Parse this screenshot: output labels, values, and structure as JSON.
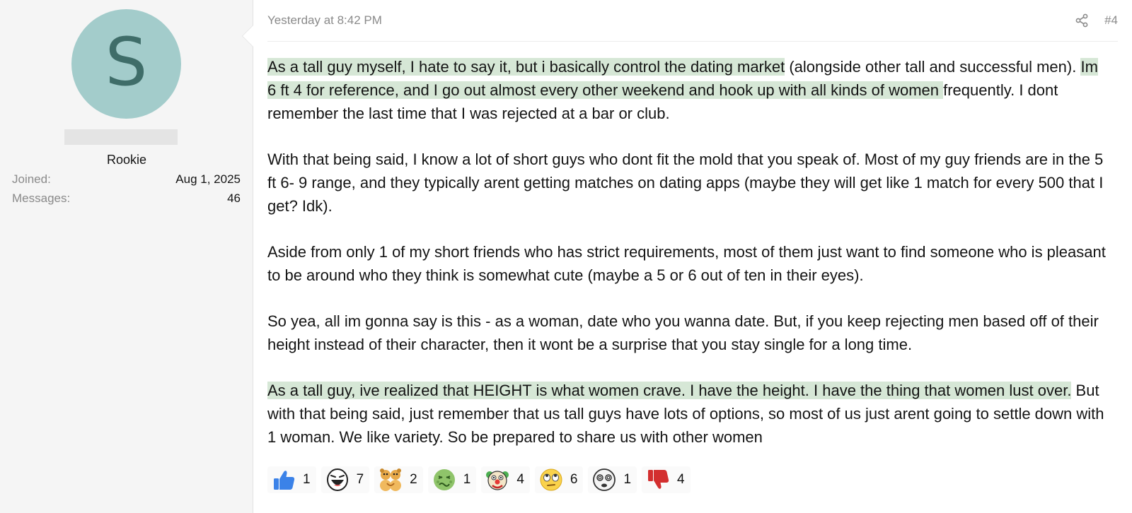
{
  "user": {
    "avatar_letter": "S",
    "title": "Rookie",
    "stats": [
      {
        "label": "Joined:",
        "value": "Aug 1, 2025"
      },
      {
        "label": "Messages:",
        "value": "46"
      }
    ]
  },
  "post": {
    "date": "Yesterday at 8:42 PM",
    "number": "#4",
    "p1": {
      "hl1": "As a tall guy myself, I hate to say it, but i basically control the dating market",
      "t1": " (alongside other tall and successful men). ",
      "hl2": "Im 6 ft 4 for reference, and I go out almost every other weekend and hook up with all kinds of women ",
      "t2": " frequently. I dont remember the last time that I was rejected at a bar or club."
    },
    "p2": "With that being said, I know a lot of short guys who dont fit the mold that you speak of. Most of my guy friends are in the 5 ft 6- 9 range, and they typically arent getting matches on dating apps (maybe they will get like 1 match for every 500 that I get? Idk).",
    "p3": "Aside from only 1 of my short friends who has strict requirements, most of them just want to find someone who is pleasant to be around who they think is somewhat cute (maybe a 5 or 6 out of ten in their eyes).",
    "p4": "So yea, all im gonna say is this - as a woman, date who you wanna date. But, if you keep rejecting men based off of their height instead of their character, then it wont be a surprise that you stay single for a long time.",
    "p5": {
      "hl1": "As a tall guy, ive realized that HEIGHT is what women crave. I have the height. I have the thing that women lust over.",
      "t1": " But with that being said, just remember that us tall guys have lots of options, so most of us just arent going to settle down with 1 woman. We like variety. So be prepared to share us with other women"
    }
  },
  "reactions": [
    {
      "icon": "thumbs-up-icon",
      "count": "1"
    },
    {
      "icon": "laughing-face-icon",
      "count": "7"
    },
    {
      "icon": "hugging-bears-icon",
      "count": "2"
    },
    {
      "icon": "nauseated-face-icon",
      "count": "1"
    },
    {
      "icon": "clown-face-icon",
      "count": "4"
    },
    {
      "icon": "eye-roll-face-icon",
      "count": "6"
    },
    {
      "icon": "dizzy-face-icon",
      "count": "1"
    },
    {
      "icon": "thumbs-down-icon",
      "count": "4"
    }
  ],
  "colors": {
    "avatar_bg": "#a3cccb",
    "avatar_letter": "#3f6d69",
    "highlight": "#d6e7d6",
    "sidebar_bg": "#f5f5f5",
    "muted_text": "#8a8a8a"
  }
}
